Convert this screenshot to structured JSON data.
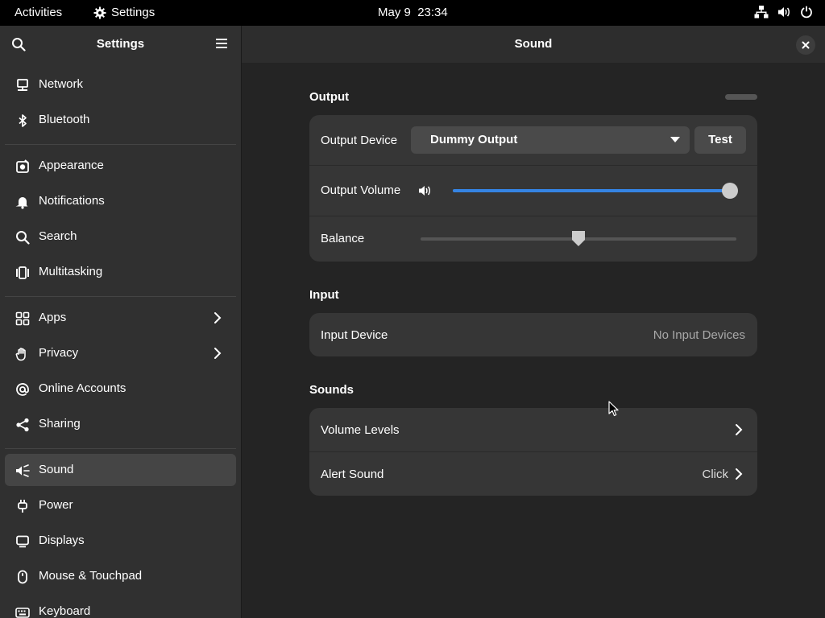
{
  "topbar": {
    "activities": "Activities",
    "app_name": "Settings",
    "date": "May 9",
    "time": "23:34",
    "icons": [
      "network-icon",
      "volume-icon",
      "power-icon"
    ]
  },
  "sidebar": {
    "title": "Settings",
    "items": [
      {
        "label": "Network",
        "icon": "network-icon"
      },
      {
        "label": "Bluetooth",
        "icon": "bluetooth-icon"
      },
      {
        "label": "Appearance",
        "icon": "appearance-icon"
      },
      {
        "label": "Notifications",
        "icon": "bell-icon"
      },
      {
        "label": "Search",
        "icon": "search-icon"
      },
      {
        "label": "Multitasking",
        "icon": "multitasking-icon"
      },
      {
        "label": "Apps",
        "icon": "apps-icon"
      },
      {
        "label": "Privacy",
        "icon": "hand-icon"
      },
      {
        "label": "Online Accounts",
        "icon": "at-icon"
      },
      {
        "label": "Sharing",
        "icon": "share-icon"
      },
      {
        "label": "Sound",
        "icon": "sound-icon"
      },
      {
        "label": "Power",
        "icon": "power-plug-icon"
      },
      {
        "label": "Displays",
        "icon": "display-icon"
      },
      {
        "label": "Mouse & Touchpad",
        "icon": "mouse-icon"
      },
      {
        "label": "Keyboard",
        "icon": "keyboard-icon"
      }
    ],
    "selected": "Sound"
  },
  "main": {
    "title": "Sound",
    "output": {
      "section_title": "Output",
      "device_label": "Output Device",
      "device_value": "Dummy Output",
      "test_label": "Test",
      "volume_label": "Output Volume",
      "volume_level": 1.0,
      "balance_label": "Balance",
      "balance_level": 0.5
    },
    "input": {
      "section_title": "Input",
      "device_label": "Input Device",
      "device_value": "No Input Devices"
    },
    "sounds": {
      "section_title": "Sounds",
      "volume_levels_label": "Volume Levels",
      "alert_label": "Alert Sound",
      "alert_value": "Click"
    }
  },
  "colors": {
    "accent": "#3584e4",
    "sidebar_bg": "#303030",
    "main_bg": "#242424",
    "card_bg": "#363636"
  }
}
